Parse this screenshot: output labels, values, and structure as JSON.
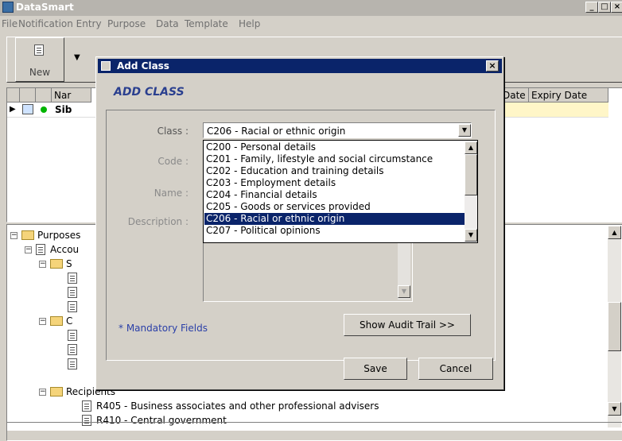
{
  "app": {
    "title": "DataSmart"
  },
  "menu": [
    "File",
    "Notification Entry",
    "Purpose",
    "Data",
    "Template",
    "Help"
  ],
  "toolbar": {
    "new_label": "New"
  },
  "grid": {
    "columns": [
      "Nar",
      "Date",
      "Expiry Date"
    ],
    "row": {
      "name": "Sib"
    }
  },
  "tree": {
    "items": [
      {
        "label": "Purposes",
        "level": 0
      },
      {
        "label": "Accou",
        "level": 1
      },
      {
        "label": "S",
        "level": 2
      },
      {
        "label": "C",
        "level": 2
      },
      {
        "label": "Recipients",
        "level": 2
      },
      {
        "label": "R405 - Business associates and other professional advisers",
        "level": 3
      },
      {
        "label": "R410 - Central government",
        "level": 3
      }
    ]
  },
  "dialog": {
    "title": "Add Class",
    "close": "×",
    "heading": "ADD CLASS",
    "labels": {
      "class": "Class :",
      "code": "Code :",
      "name": "Name :",
      "description": "Description :"
    },
    "class_value": "C206 - Racial or ethnic origin",
    "options": [
      "C200 - Personal details",
      "C201 - Family, lifestyle and social circumstance",
      "C202 - Education and training details",
      "C203 - Employment details",
      "C204 - Financial details",
      "C205 - Goods or services provided",
      "C206 - Racial or ethnic origin",
      "C207 - Political opinions"
    ],
    "selected_index": 6,
    "mandatory_note": "* Mandatory Fields",
    "audit_button": "Show Audit Trail >>",
    "save_button": "Save",
    "cancel_button": "Cancel"
  }
}
